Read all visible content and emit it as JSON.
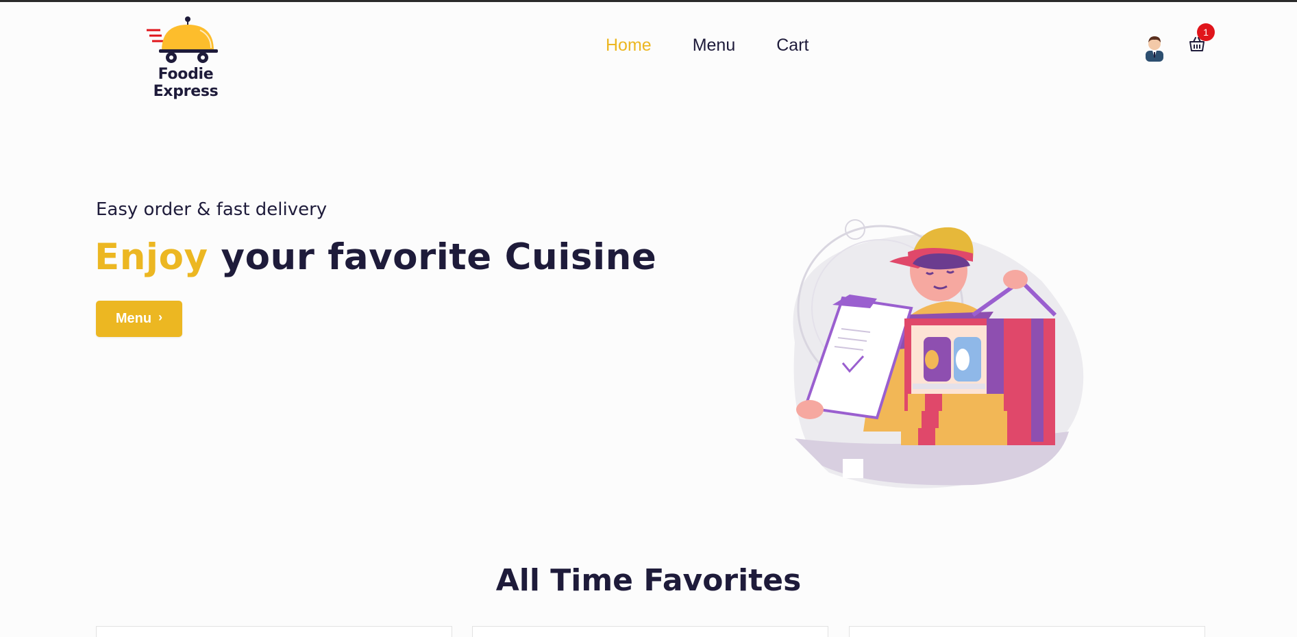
{
  "brand": {
    "name": "Foodie Express"
  },
  "nav": {
    "items": [
      {
        "label": "Home",
        "active": true
      },
      {
        "label": "Menu",
        "active": false
      },
      {
        "label": "Cart",
        "active": false
      }
    ]
  },
  "header": {
    "user_icon": "user-avatar-icon",
    "cart_icon": "shopping-basket-icon",
    "cart_count": "1"
  },
  "hero": {
    "subtitle": "Easy order & fast delivery",
    "title_accent": "Enjoy",
    "title_rest": " your favorite Cuisine",
    "button_label": "Menu",
    "button_icon": "chevron-right-icon"
  },
  "favorites": {
    "title": "All Time Favorites"
  },
  "colors": {
    "accent": "#ecb722",
    "text": "#1e1b3a",
    "badge": "#e0151b"
  }
}
